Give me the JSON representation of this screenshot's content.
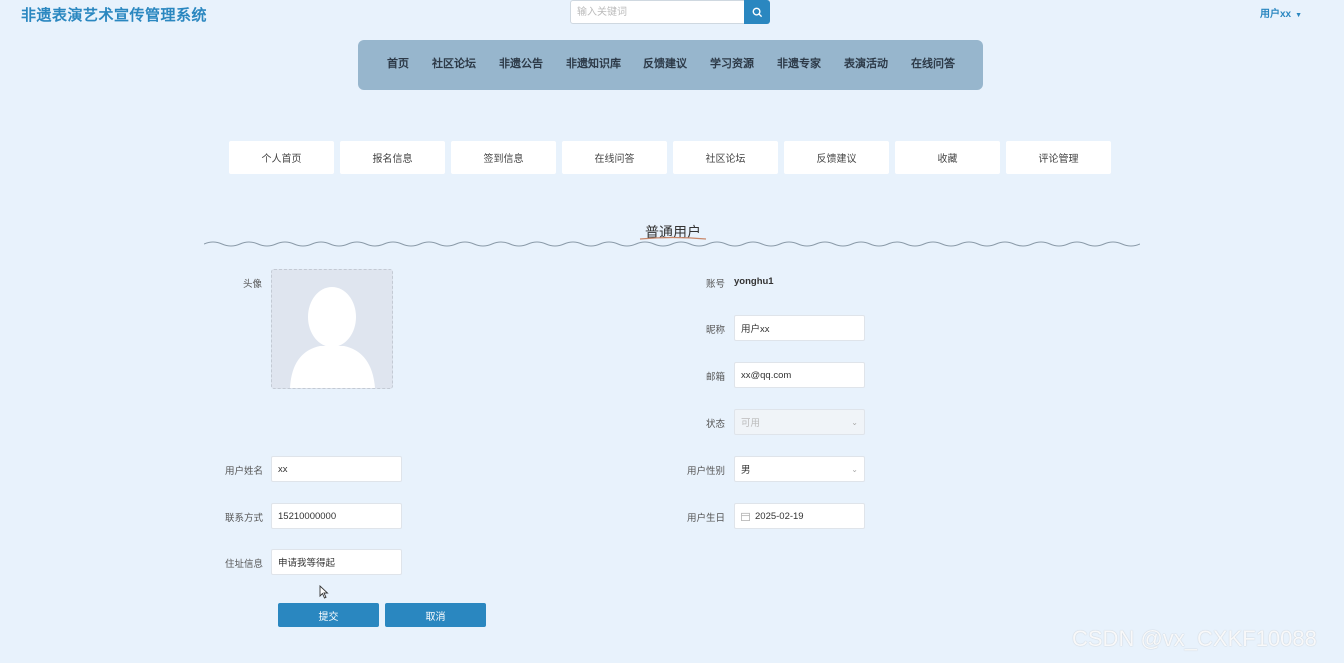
{
  "header": {
    "app_title": "非遗表演艺术宣传管理系统",
    "search_placeholder": "输入关键词",
    "search_icon": "search-icon",
    "user_label": "用户xx"
  },
  "nav": {
    "items": [
      "首页",
      "社区论坛",
      "非遗公告",
      "非遗知识库",
      "反馈建议",
      "学习资源",
      "非遗专家",
      "表演活动",
      "在线问答"
    ]
  },
  "subnav": {
    "items": [
      "个人首页",
      "报名信息",
      "签到信息",
      "在线问答",
      "社区论坛",
      "反馈建议",
      "收藏",
      "评论管理"
    ]
  },
  "section_title": "普通用户",
  "form": {
    "avatar_label": "头像",
    "account_label": "账号",
    "account_value": "yonghu1",
    "nickname_label": "昵称",
    "nickname_value": "用户xx",
    "email_label": "邮箱",
    "email_value": "xx@qq.com",
    "status_label": "状态",
    "status_value": "可用",
    "name_label": "用户姓名",
    "name_value": "xx",
    "gender_label": "用户性别",
    "gender_value": "男",
    "phone_label": "联系方式",
    "phone_value": "15210000000",
    "birthday_label": "用户生日",
    "birthday_value": "2025-02-19",
    "address_label": "住址信息",
    "address_value": "申请我等得起",
    "submit_label": "提交",
    "cancel_label": "取消"
  },
  "watermark": "CSDN @vx_CXKF10088",
  "colors": {
    "accent": "#2a87c0",
    "nav_bg": "#97b6cd",
    "page_bg": "#e8f2fc"
  }
}
